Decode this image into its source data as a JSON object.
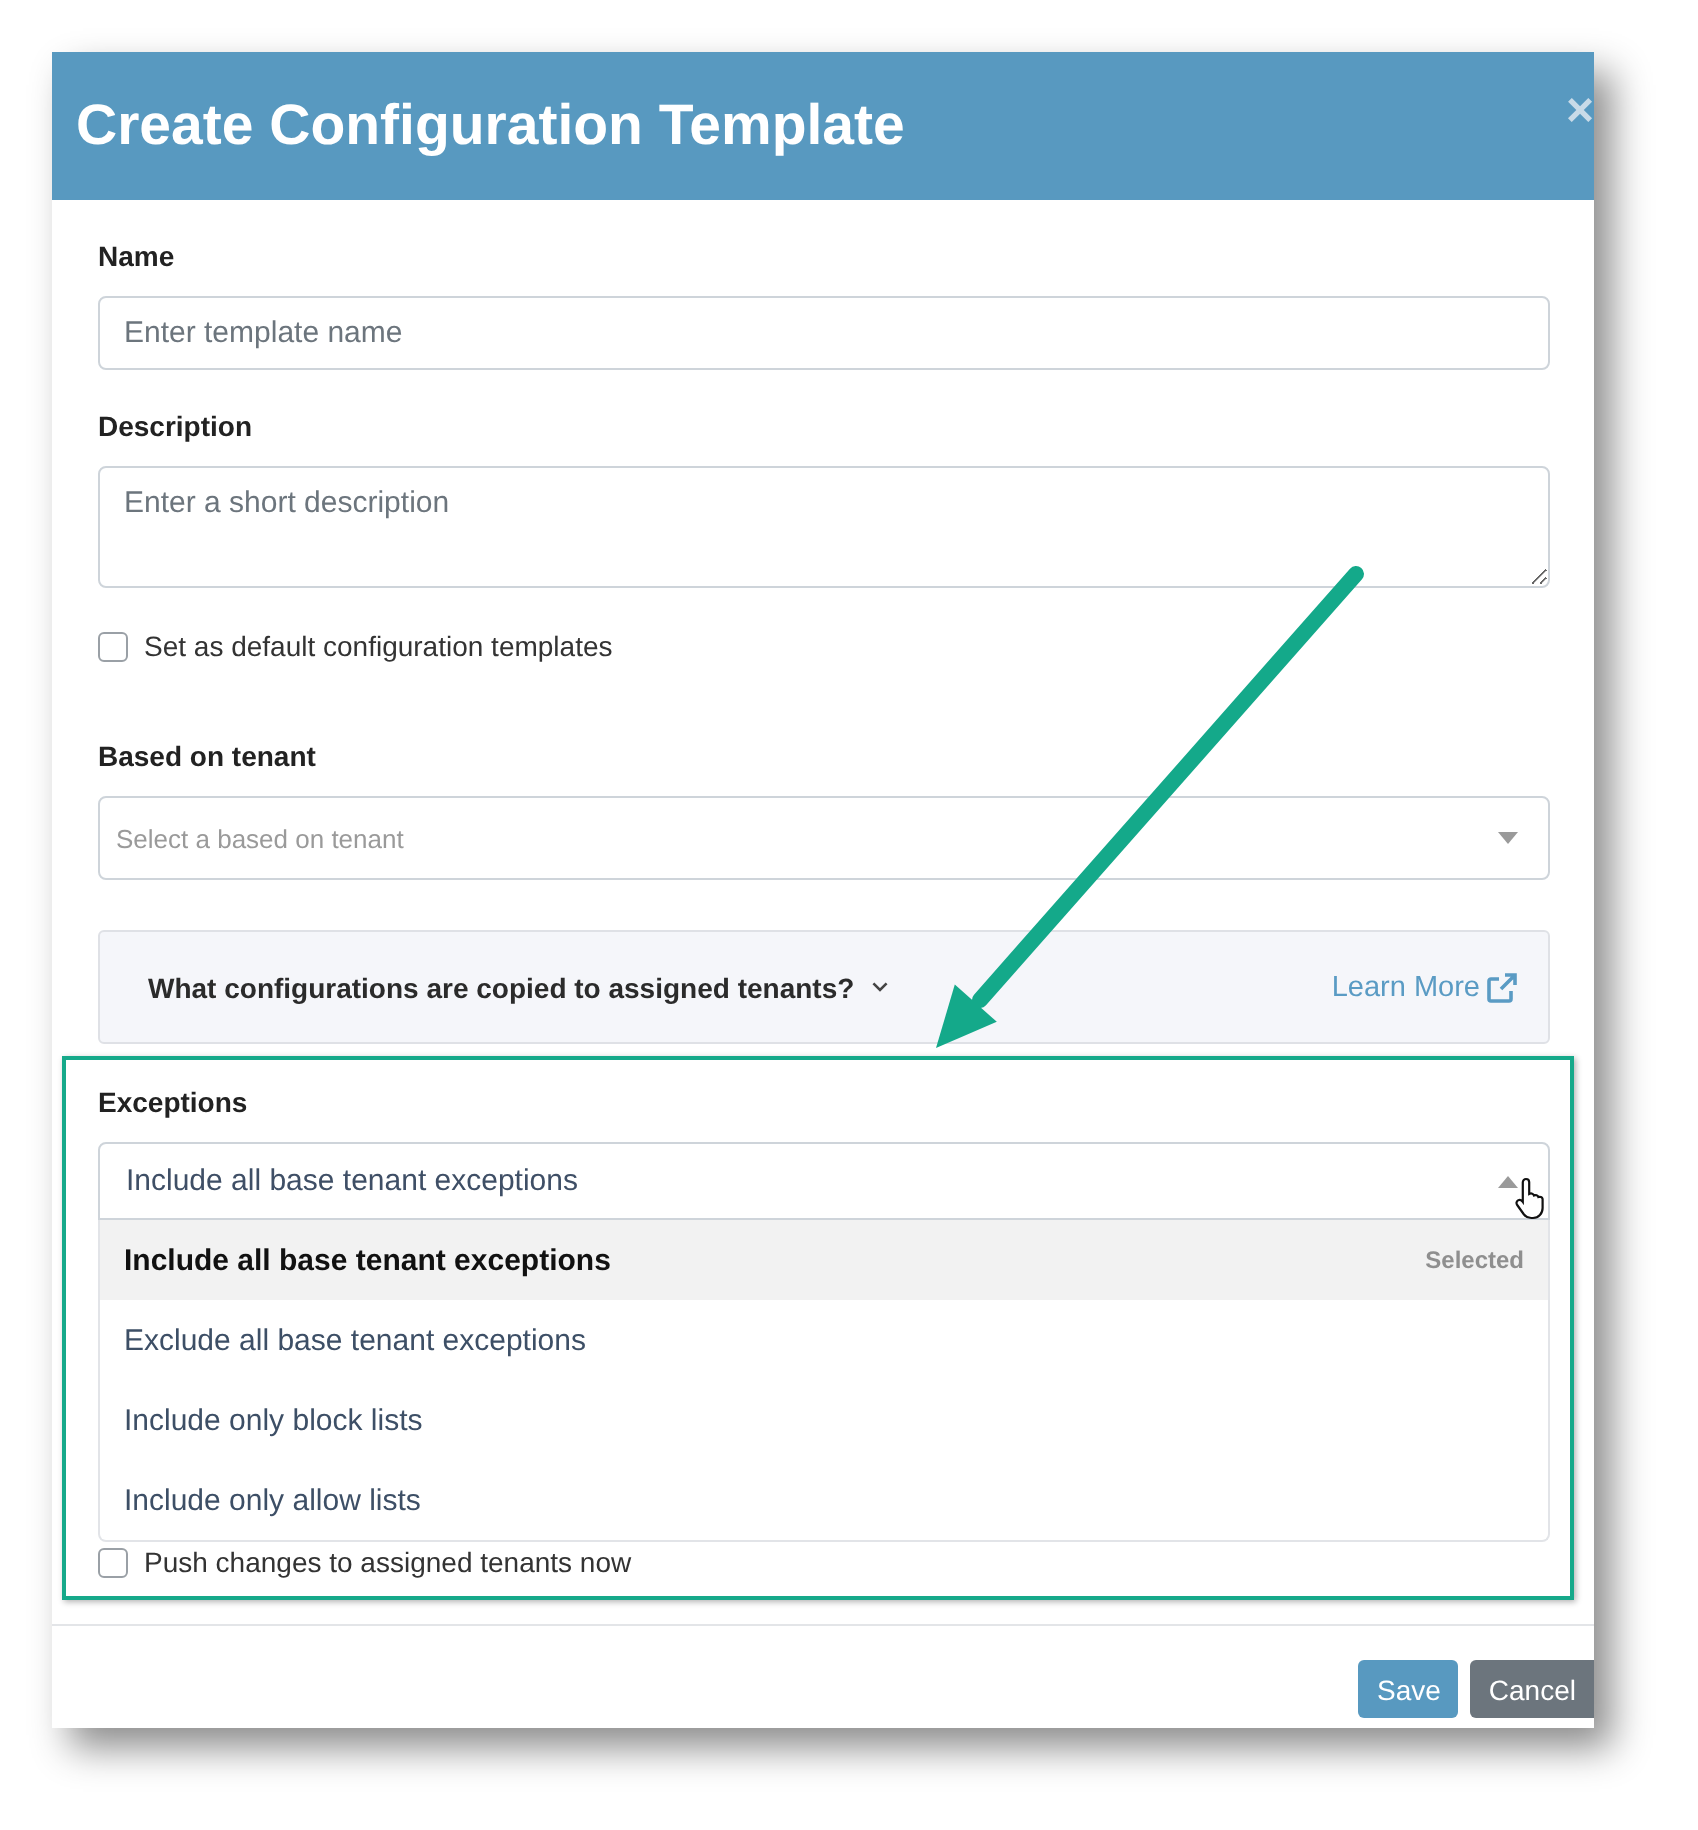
{
  "dialog": {
    "title": "Create Configuration Template",
    "close": "×"
  },
  "fields": [
    {
      "kind": "input",
      "label": "Name",
      "placeholder": "Enter template name"
    },
    {
      "kind": "textarea",
      "label": "Description",
      "placeholder": "Enter a short description"
    },
    {
      "kind": "checkbox",
      "label": "Set as default configuration templates",
      "checked": false
    },
    {
      "kind": "select",
      "label": "Based on tenant",
      "placeholder": "Select a based on tenant",
      "expanded": false
    },
    {
      "kind": "info",
      "text": "What configurations are copied to assigned tenants?",
      "link": "Learn More"
    },
    {
      "kind": "select",
      "label": "Exceptions",
      "value": "Include all base tenant exceptions",
      "expanded": true,
      "selected_note": "Selected",
      "options": [
        {
          "label": "Include all base tenant exceptions",
          "selected": true
        },
        {
          "label": "Exclude all base tenant exceptions",
          "selected": false
        },
        {
          "label": "Include only block lists",
          "selected": false
        },
        {
          "label": "Include only allow lists",
          "selected": false
        }
      ]
    },
    {
      "kind": "checkbox",
      "label": "Push changes to assigned tenants now",
      "checked": false
    }
  ],
  "buttons": [
    {
      "label": "Save",
      "kind": "primary"
    },
    {
      "label": "Cancel",
      "kind": "secondary"
    }
  ]
}
